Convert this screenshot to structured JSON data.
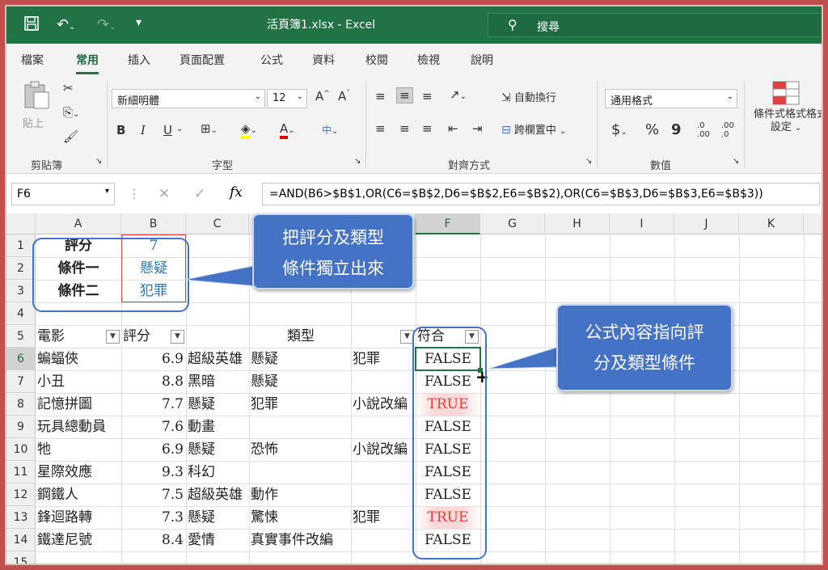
{
  "window": {
    "title": "活頁簿1.xlsx  -  Excel",
    "search_label": "搜尋",
    "accent": "#217346"
  },
  "tabs": [
    "檔案",
    "常用",
    "插入",
    "頁面配置",
    "公式",
    "資料",
    "校閱",
    "檢視",
    "說明"
  ],
  "ribbon": {
    "clipboard": {
      "paste": "貼上",
      "group": "剪貼簿"
    },
    "font": {
      "name": "新細明體",
      "size": "12",
      "group": "字型",
      "bold": "B",
      "italic": "I",
      "underline": "U",
      "phonetic": "中"
    },
    "align": {
      "wrap": "自動換行",
      "merge": "跨欄置中",
      "group": "對齊方式"
    },
    "number": {
      "format": "通用格式",
      "currency": "$",
      "percent": "%",
      "comma": "9",
      "group": "數值",
      "inc_dec": ".0 .00",
      "dec_dec": ".00 .0"
    },
    "styles": {
      "cond_format": "條件式格式",
      "cond_format2": "設定",
      "next": "格式"
    }
  },
  "formula_bar": {
    "name_box": "F6",
    "fx": "fx",
    "formula": "=AND(B6>$B$1,OR(C6=$B$2,D6=$B$2,E6=$B$2),OR(C6=$B$3,D6=$B$3,E6=$B$3))"
  },
  "columns": [
    "A",
    "B",
    "C",
    "D",
    "E",
    "F",
    "G",
    "H",
    "I",
    "J",
    "K"
  ],
  "rows": [
    "1",
    "2",
    "3",
    "4",
    "5",
    "6",
    "7",
    "8",
    "9",
    "10",
    "11",
    "12",
    "13",
    "14",
    "15"
  ],
  "criteria": [
    {
      "label": "評分",
      "value": "7"
    },
    {
      "label": "條件一",
      "value": "懸疑"
    },
    {
      "label": "條件二",
      "value": "犯罪"
    }
  ],
  "table_header": {
    "movie": "電影",
    "score": "評分",
    "genre": "類型",
    "match": "符合"
  },
  "table_rows": [
    {
      "movie": "蝙蝠俠",
      "score": "6.9",
      "g1": "超級英雄",
      "g2": "懸疑",
      "g3": "犯罪",
      "match": "FALSE"
    },
    {
      "movie": "小丑",
      "score": "8.8",
      "g1": "黑暗",
      "g2": "懸疑",
      "g3": "",
      "match": "FALSE"
    },
    {
      "movie": "記憶拼圖",
      "score": "7.7",
      "g1": "懸疑",
      "g2": "犯罪",
      "g3": "小說改編",
      "match": "TRUE"
    },
    {
      "movie": "玩具總動員",
      "score": "7.6",
      "g1": "動畫",
      "g2": "",
      "g3": "",
      "match": "FALSE"
    },
    {
      "movie": "牠",
      "score": "6.9",
      "g1": "懸疑",
      "g2": "恐怖",
      "g3": "小說改編",
      "match": "FALSE"
    },
    {
      "movie": "星際效應",
      "score": "9.3",
      "g1": "科幻",
      "g2": "",
      "g3": "",
      "match": "FALSE"
    },
    {
      "movie": "鋼鐵人",
      "score": "7.5",
      "g1": "超級英雄",
      "g2": "動作",
      "g3": "",
      "match": "FALSE"
    },
    {
      "movie": "鋒迴路轉",
      "score": "7.3",
      "g1": "懸疑",
      "g2": "驚悚",
      "g3": "犯罪",
      "match": "TRUE"
    },
    {
      "movie": "鐵達尼號",
      "score": "8.4",
      "g1": "愛情",
      "g2": "真實事件改編",
      "g3": "",
      "match": "FALSE"
    }
  ],
  "annotations": {
    "callout1_line1": "把評分及類型",
    "callout1_line2": "條件獨立出來",
    "callout2_line1": "公式內容指向評",
    "callout2_line2": "分及類型條件",
    "color": "#4472c4"
  },
  "colors": {
    "true_text": "#e04040",
    "false_text": "#222222",
    "criteria_value": "#2e75b6"
  }
}
